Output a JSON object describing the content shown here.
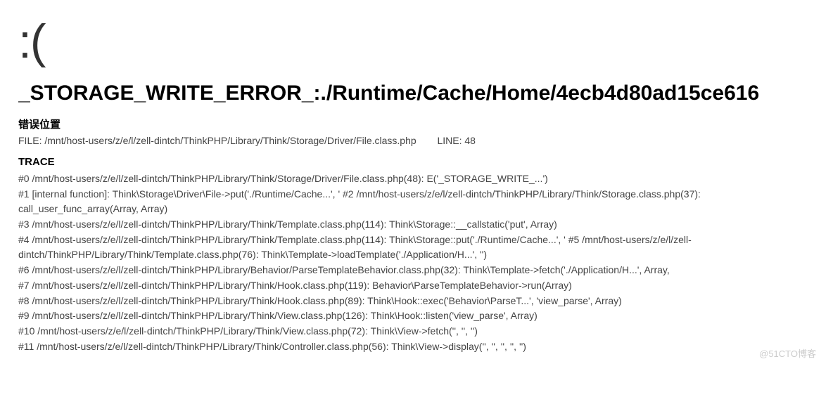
{
  "face": ":(",
  "title": "_STORAGE_WRITE_ERROR_:./Runtime/Cache/Home/4ecb4d80ad15ce616",
  "location": {
    "heading": "错误位置",
    "file_label": "FILE:",
    "file_path": "/mnt/host-users/z/e/l/zell-dintch/ThinkPHP/Library/Think/Storage/Driver/File.class.php",
    "line_label": "LINE:",
    "line_number": "48"
  },
  "trace_heading": "TRACE",
  "trace": [
    "#0 /mnt/host-users/z/e/l/zell-dintch/ThinkPHP/Library/Think/Storage/Driver/File.class.php(48): E('_STORAGE_WRITE_...')",
    "#1 [internal function]: Think\\Storage\\Driver\\File->put('./Runtime/Cache...', ' #2 /mnt/host-users/z/e/l/zell-dintch/ThinkPHP/Library/Think/Storage.class.php(37): call_user_func_array(Array, Array)",
    "#3 /mnt/host-users/z/e/l/zell-dintch/ThinkPHP/Library/Think/Template.class.php(114): Think\\Storage::__callstatic('put', Array)",
    "#4 /mnt/host-users/z/e/l/zell-dintch/ThinkPHP/Library/Think/Template.class.php(114): Think\\Storage::put('./Runtime/Cache...', ' #5 /mnt/host-users/z/e/l/zell-dintch/ThinkPHP/Library/Think/Template.class.php(76): Think\\Template->loadTemplate('./Application/H...', '')",
    "#6 /mnt/host-users/z/e/l/zell-dintch/ThinkPHP/Library/Behavior/ParseTemplateBehavior.class.php(32): Think\\Template->fetch('./Application/H...', Array,",
    "#7 /mnt/host-users/z/e/l/zell-dintch/ThinkPHP/Library/Think/Hook.class.php(119): Behavior\\ParseTemplateBehavior->run(Array)",
    "#8 /mnt/host-users/z/e/l/zell-dintch/ThinkPHP/Library/Think/Hook.class.php(89): Think\\Hook::exec('Behavior\\ParseT...', 'view_parse', Array)",
    "#9 /mnt/host-users/z/e/l/zell-dintch/ThinkPHP/Library/Think/View.class.php(126): Think\\Hook::listen('view_parse', Array)",
    "#10 /mnt/host-users/z/e/l/zell-dintch/ThinkPHP/Library/Think/View.class.php(72): Think\\View->fetch('', '', '')",
    "#11 /mnt/host-users/z/e/l/zell-dintch/ThinkPHP/Library/Think/Controller.class.php(56): Think\\View->display('', '', '', '', '')"
  ],
  "watermark": "@51CTO博客"
}
